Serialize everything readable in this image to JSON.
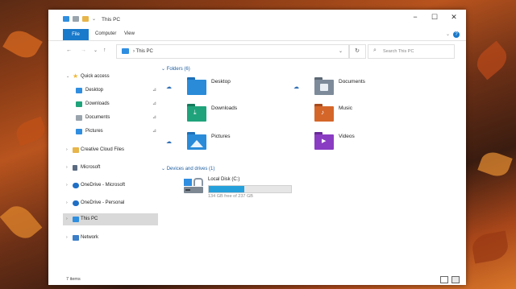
{
  "window": {
    "title": "This PC",
    "controls": {
      "minimize": "−",
      "maximize": "☐",
      "close": "✕"
    }
  },
  "ribbon": {
    "tabs": [
      "File",
      "Computer",
      "View"
    ],
    "help": "?",
    "collapse": "⌄"
  },
  "addressbar": {
    "back": "←",
    "forward": "→",
    "recent": "⌄",
    "up": "↑",
    "path": "›  This PC",
    "dropdown": "⌄",
    "refresh": "↻",
    "search_placeholder": "Search This PC"
  },
  "nav": {
    "items": [
      {
        "label": "Quick access",
        "icon": "star-icon",
        "chevron": "⌄",
        "pinned": false
      },
      {
        "label": "Desktop",
        "icon": "desktop-icon",
        "chevron": "",
        "pinned": true
      },
      {
        "label": "Downloads",
        "icon": "downloads-icon",
        "chevron": "",
        "pinned": true
      },
      {
        "label": "Documents",
        "icon": "documents-icon",
        "chevron": "",
        "pinned": true
      },
      {
        "label": "Pictures",
        "icon": "pictures-icon",
        "chevron": "",
        "pinned": true
      },
      {
        "label": "Creative Cloud Files",
        "icon": "creative-cloud-icon",
        "chevron": "›",
        "pinned": false
      },
      {
        "label": "Microsoft",
        "icon": "document-icon",
        "chevron": "›",
        "pinned": false
      },
      {
        "label": "OneDrive - Microsoft",
        "icon": "onedrive-icon",
        "chevron": "›",
        "pinned": false
      },
      {
        "label": "OneDrive - Personal",
        "icon": "onedrive-icon",
        "chevron": "›",
        "pinned": false
      },
      {
        "label": "This PC",
        "icon": "this-pc-icon",
        "chevron": "›",
        "pinned": false,
        "selected": true
      },
      {
        "label": "Network",
        "icon": "network-icon",
        "chevron": "›",
        "pinned": false
      }
    ],
    "pin_glyph": "⊿"
  },
  "content": {
    "folders_header": "⌄  Folders (6)",
    "folders": [
      {
        "label": "Desktop",
        "icon": "desktop-folder-icon",
        "synced": true,
        "color": "#2a8bd8"
      },
      {
        "label": "Documents",
        "icon": "documents-folder-icon",
        "synced": true,
        "color": "#7d8a99"
      },
      {
        "label": "Downloads",
        "icon": "downloads-folder-icon",
        "synced": false,
        "color": "#1fa37a"
      },
      {
        "label": "Music",
        "icon": "music-folder-icon",
        "synced": false,
        "color": "#d4662a"
      },
      {
        "label": "Pictures",
        "icon": "pictures-folder-icon",
        "synced": true,
        "color": "#2a8bd8"
      },
      {
        "label": "Videos",
        "icon": "videos-folder-icon",
        "synced": false,
        "color": "#8a3cc2"
      }
    ],
    "sync_glyph": "☁",
    "drives_header": "⌄  Devices and drives (1)",
    "drive": {
      "name": "Local Disk (C:)",
      "free_text": "134 GB free of 237 GB",
      "used_fraction": 0.435
    }
  },
  "status": {
    "items": "7 items"
  },
  "colors": {
    "accent": "#1979ca",
    "progress": "#26a0da",
    "selection": "#d9d9d9"
  }
}
